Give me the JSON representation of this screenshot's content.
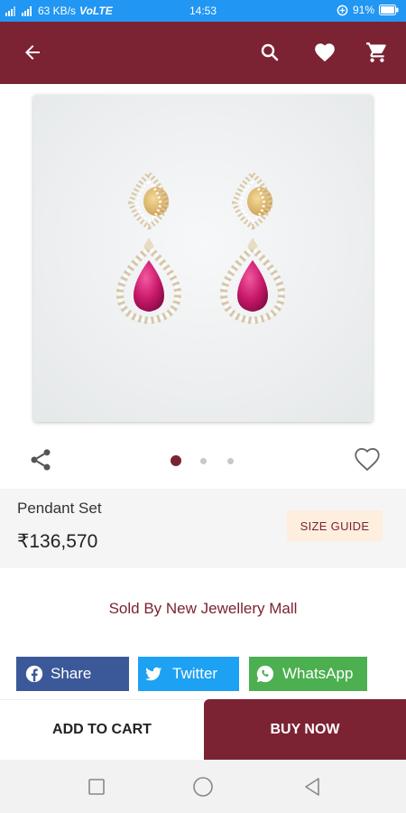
{
  "status_bar": {
    "network_speed": "63 KB/s",
    "volte": "VoLTE",
    "time": "14:53",
    "battery": "91%"
  },
  "app_bar": {
    "icons": [
      "back-arrow-icon",
      "search-icon",
      "heart-icon",
      "cart-icon"
    ],
    "background": "#7b2333"
  },
  "gallery": {
    "image_alt": "Ruby and diamond drop earrings",
    "page_count": 3,
    "active_page": 1
  },
  "product": {
    "name": "Pendant Set",
    "price": "₹136,570",
    "size_guide_label": "SIZE GUIDE"
  },
  "seller": {
    "sold_by_text": "Sold By New Jewellery Mall"
  },
  "social": [
    {
      "label": "Share",
      "icon": "facebook-icon",
      "color": "#3b5998"
    },
    {
      "label": "Twitter",
      "icon": "twitter-icon",
      "color": "#1da1f2"
    },
    {
      "label": "WhatsApp",
      "icon": "whatsapp-icon",
      "color": "#4caf50"
    }
  ],
  "actions": {
    "add_to_cart": "ADD TO CART",
    "buy_now": "BUY NOW"
  },
  "colors": {
    "brand": "#7b2333",
    "status_bar": "#2196f3",
    "size_guide_bg": "#fdeedd"
  }
}
